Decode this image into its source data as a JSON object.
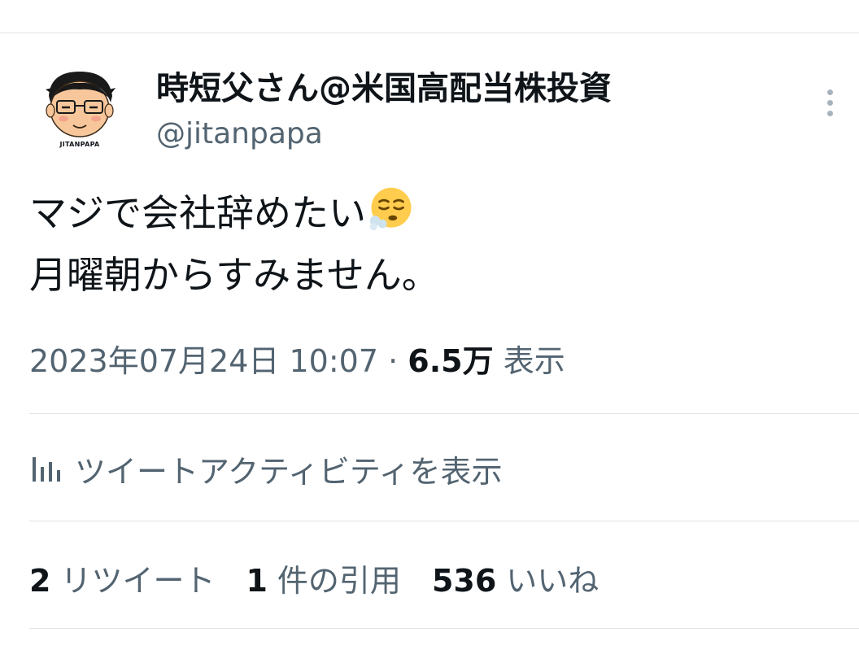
{
  "author": {
    "display_name": "時短父さん@米国高配当株投資",
    "handle": "@jitanpapa",
    "avatar_caption": "JITANPAPA"
  },
  "tweet": {
    "line1": "マジで会社辞めたい",
    "line1_emoji": "exhale-face-emoji",
    "line2": "月曜朝からすみません。"
  },
  "meta": {
    "datetime": "2023年07月24日 10:07",
    "separator": "·",
    "views_count": "6.5万",
    "views_label": "表示"
  },
  "activity": {
    "icon": "bar-chart-icon",
    "label": "ツイートアクティビティを表示"
  },
  "stats": [
    {
      "count": "2",
      "label": "リツイート"
    },
    {
      "count": "1",
      "label": "件の引用"
    },
    {
      "count": "536",
      "label": "いいね"
    }
  ],
  "colors": {
    "primary_text": "#0f1419",
    "secondary_text": "#536471",
    "divider": "#dfe3e6"
  }
}
